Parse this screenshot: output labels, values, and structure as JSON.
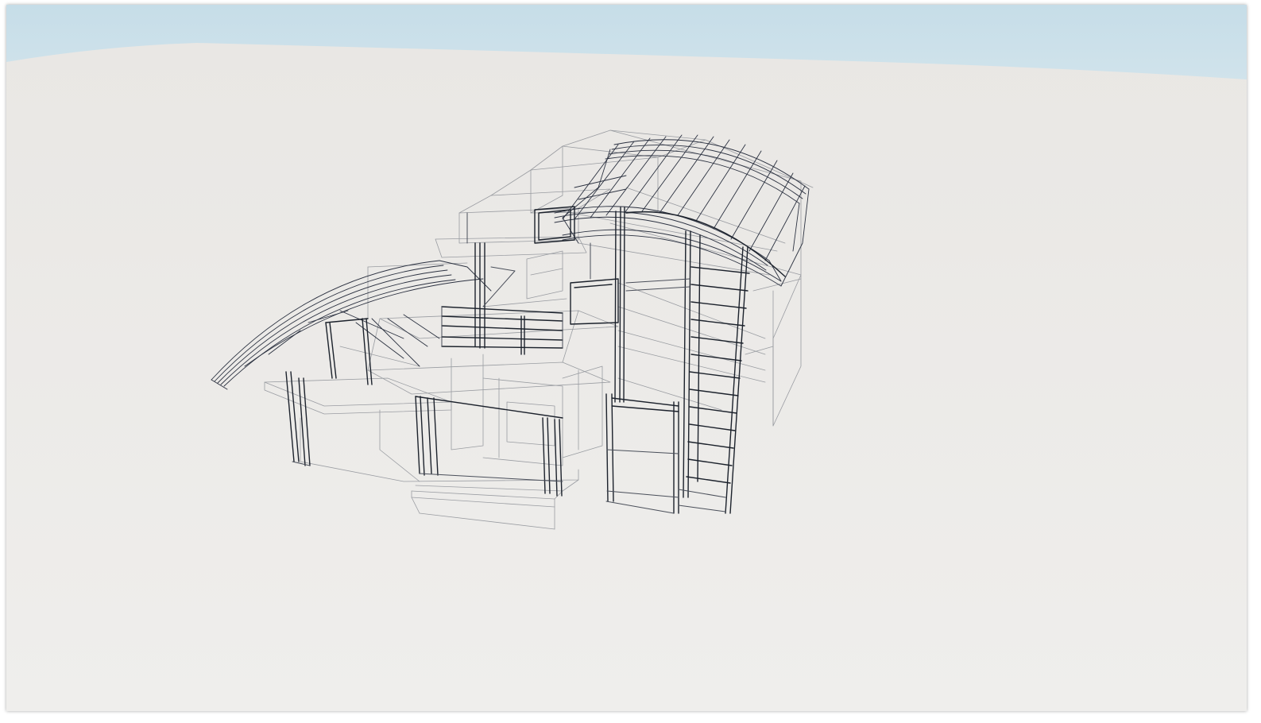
{
  "viewport": {
    "view_mode": "wireframe",
    "subject": "house-model",
    "colors": {
      "sky": "#c9dfe8",
      "ground": "#ecebe8",
      "wire_light": "#8a8d93",
      "wire_dark": "#1f2530"
    }
  }
}
